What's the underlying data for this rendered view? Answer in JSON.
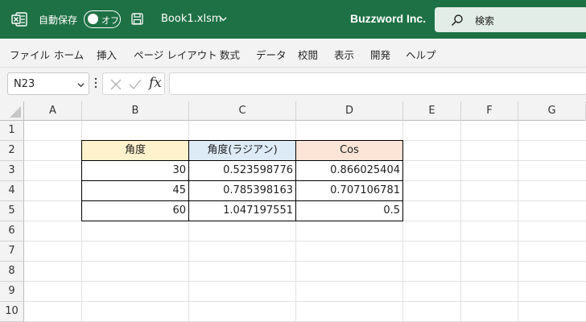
{
  "titlebar": {
    "autosave_label": "自動保存",
    "autosave_state": "オフ",
    "filename": "Book1.xlsm",
    "company": "Buzzword Inc.",
    "search_placeholder": "検索",
    "background_color": "#1e7145"
  },
  "menu": {
    "items": [
      "ファイル",
      "ホーム",
      "挿入",
      "ページ レイアウト",
      "数式",
      "データ",
      "校閲",
      "表示",
      "開発",
      "ヘルプ"
    ]
  },
  "formula_bar": {
    "name_box": "N23",
    "fx_label": "fx",
    "formula": ""
  },
  "sheet": {
    "columns": [
      "A",
      "B",
      "C",
      "D",
      "E",
      "F",
      "G"
    ],
    "rows": [
      "1",
      "2",
      "3",
      "4",
      "5",
      "6",
      "7",
      "8",
      "9",
      "10"
    ],
    "table": {
      "headers": [
        {
          "text": "角度",
          "fill": "#fff2cc"
        },
        {
          "text": "角度(ラジアン)",
          "fill": "#ddebf7"
        },
        {
          "text": "Cos",
          "fill": "#fce4d6"
        }
      ],
      "rows": [
        [
          "30",
          "0.523598776",
          "0.866025404"
        ],
        [
          "45",
          "0.785398163",
          "0.707106781"
        ],
        [
          "60",
          "1.047197551",
          "0.5"
        ]
      ]
    }
  }
}
